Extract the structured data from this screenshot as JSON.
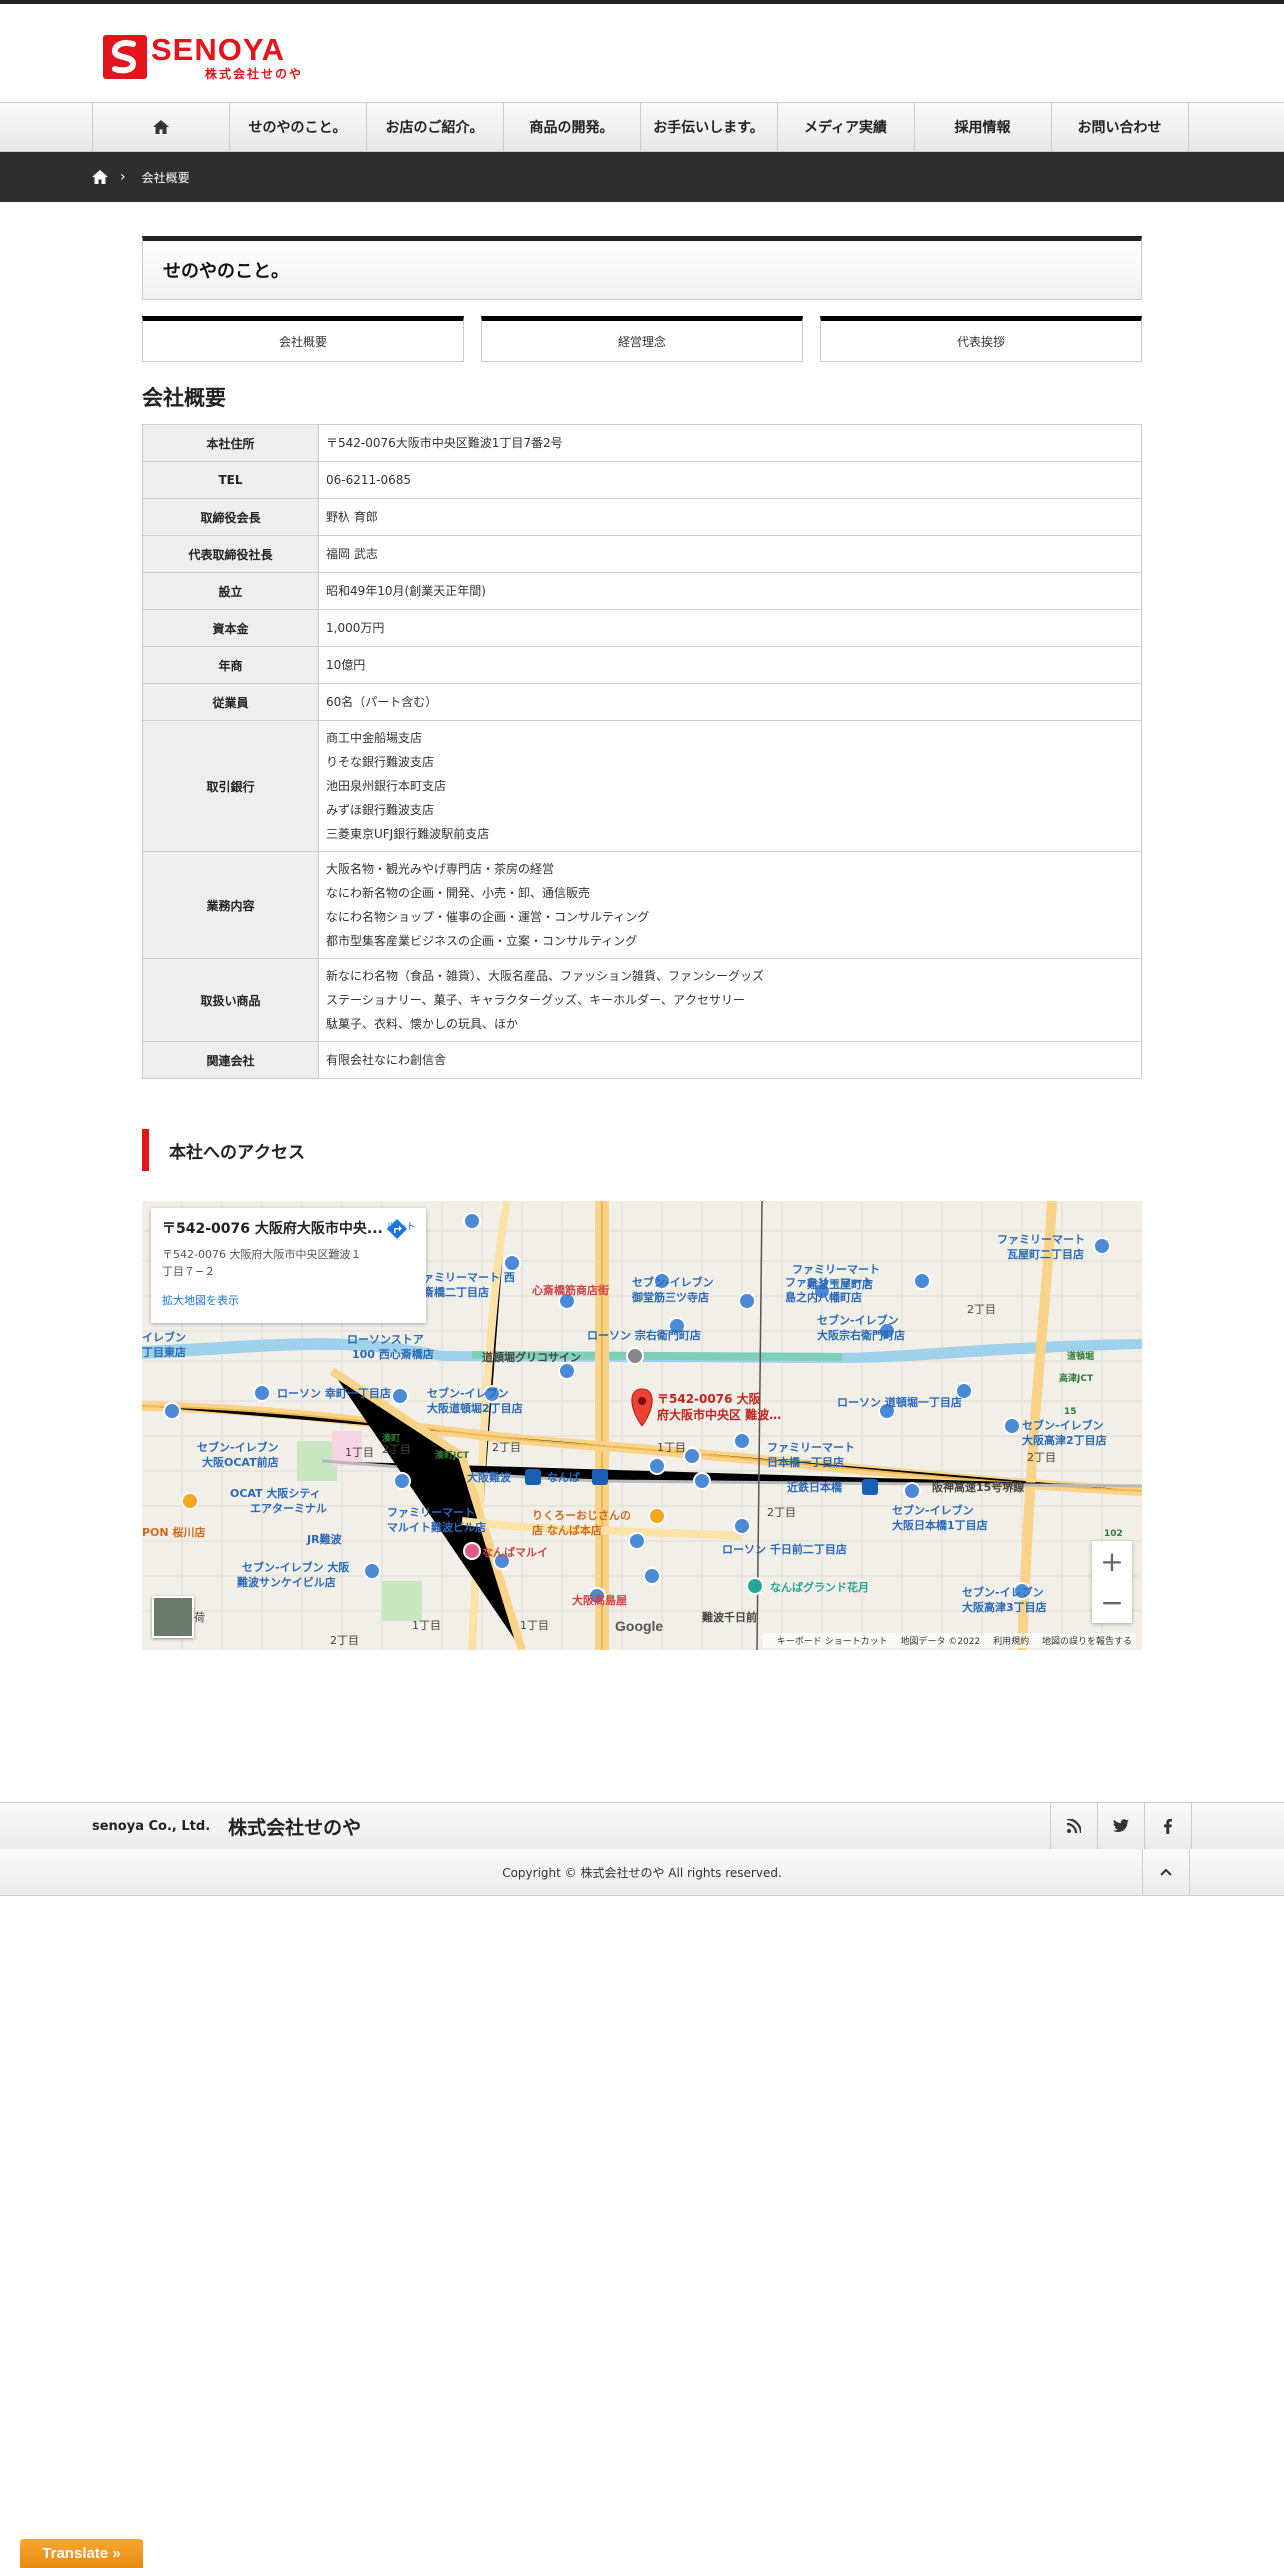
{
  "logo": {
    "name_en": "SENOYA",
    "name_jp": "株式会社せのや"
  },
  "nav": {
    "items": [
      "せのやのこと。",
      "お店のご紹介。",
      "商品の開発。",
      "お手伝いします。",
      "メディア実績",
      "採用情報",
      "お問い合わせ"
    ]
  },
  "breadcrumb": {
    "current": "会社概要"
  },
  "page": {
    "title": "せのやのこと。",
    "tabs": [
      "会社概要",
      "経営理念",
      "代表挨拶"
    ],
    "section_title": "会社概要"
  },
  "company_table": [
    {
      "label": "本社住所",
      "lines": [
        "〒542-0076大阪市中央区難波1丁目7番2号"
      ]
    },
    {
      "label": "TEL",
      "lines": [
        "06-6211-0685"
      ]
    },
    {
      "label": "取締役会長",
      "lines": [
        "野杁 育郎"
      ]
    },
    {
      "label": "代表取締役社長",
      "lines": [
        "福岡 武志"
      ]
    },
    {
      "label": "設立",
      "lines": [
        "昭和49年10月(創業天正年間)"
      ]
    },
    {
      "label": "資本金",
      "lines": [
        "1,000万円"
      ]
    },
    {
      "label": "年商",
      "lines": [
        "10億円"
      ]
    },
    {
      "label": "従業員",
      "lines": [
        "60名（パート含む）"
      ]
    },
    {
      "label": "取引銀行",
      "lines": [
        "商工中金船場支店",
        "りそな銀行難波支店",
        "池田泉州銀行本町支店",
        "みずほ銀行難波支店",
        "三菱東京UFJ銀行難波駅前支店"
      ]
    },
    {
      "label": "業務内容",
      "lines": [
        "大阪名物・観光みやげ専門店・茶房の経営",
        "なにわ新名物の企画・開発、小売・卸、通信販売",
        "なにわ名物ショップ・催事の企画・運営・コンサルティング",
        "都市型集客産業ビジネスの企画・立案・コンサルティング"
      ]
    },
    {
      "label": "取扱い商品",
      "lines": [
        "新なにわ名物（食品・雑貨）、大阪名産品、ファッション雑貨、ファンシーグッズ",
        "ステーショナリー、菓子、キャラクターグッズ、キーホルダー、アクセサリー",
        "駄菓子、衣料、懐かしの玩具、ほか"
      ]
    },
    {
      "label": "関連会社",
      "lines": [
        "有限会社なにわ創信舎"
      ]
    }
  ],
  "access": {
    "title": "本社へのアクセス"
  },
  "map": {
    "card_title": "〒542-0076 大阪府大阪市中央...",
    "card_address": "〒542-0076 大阪府大阪市中央区難波１丁目７−２",
    "card_link": "拡大地図を表示",
    "route_label": "ルート",
    "pin_label_1": "〒542-0076 大阪",
    "pin_label_2": "府大阪市中央区 難波…",
    "labels": {
      "l1": "心斎橋筋商店街",
      "l2": "ファミリーマート",
      "l3": "島之内八幡町店",
      "l4": "ファミリーマート 西",
      "l5": "心斎橋二丁目店",
      "l6": "セブン-イレブン",
      "l7": "御堂筋三ツ寺店",
      "l8": "ファミリーマート",
      "l9": "難波玉屋町店",
      "l10": "ローソンストア",
      "l11": "100 西心斎橋店",
      "l12": "ローソン 宗右衛門町店",
      "l13": "セブン-イレブン",
      "l14": "大阪宗右衛門町店",
      "l15": "道頓堀グリコサイン",
      "l16": "ローソン 幸町一丁目店",
      "l17": "セブン-イレブン",
      "l18": "大阪道頓堀2丁目店",
      "l19": "ローソン 道頓堀一丁目店",
      "l20": "ファミリーマート",
      "l21": "日本橋一丁目店",
      "l22": "セブン-イレブン",
      "l23": "大阪OCAT前店",
      "l24": "OCAT 大阪シティ",
      "l25": "エアターミナル",
      "l26": "大阪難波",
      "l27": "なんば",
      "l28": "近鉄日本橋",
      "l29": "阪神高速15号堺線",
      "l30": "ファミリーマート",
      "l31": "マルイト難波ビル店",
      "l32": "りくろーおじさんの",
      "l33": "店 なんば本店",
      "l34": "JR難波",
      "l35": "なんばマルイ",
      "l36": "ローソン 千日前二丁目店",
      "l37": "なんばグランド花月",
      "l38": "大阪高島屋",
      "l39": "難波千日前",
      "l40": "セブン-イレブン 大阪",
      "l41": "難波サンケイビル店",
      "l42": "2丁目",
      "l43": "1丁目",
      "l44": "ファミリーマート",
      "l45": "瓦屋町二丁目店",
      "l46": "セブン-イレブン",
      "l47": "大阪高津2丁目店",
      "l48": "セブン-イレブン",
      "l49": "大阪日本橋1丁目店",
      "l50": "セブン-イレブン",
      "l51": "大阪高津3丁目店",
      "l52": "PON 桜川店",
      "l53": "荷",
      "l54": "2丁目",
      "l55": "1丁目",
      "l56": "2丁目",
      "l57": "1丁目",
      "l58": "2丁目",
      "l59": "2丁目",
      "l60": "1丁目",
      "l61": "2丁目",
      "l62": "イレブン",
      "l63": "丁目東店",
      "l64": "道頓堀",
      "l65": "高津JCT",
      "l66": "湊町",
      "l67": "湊町JCT",
      "l68": "15",
      "l69": "102"
    },
    "footer_keyboard": "キーボード ショートカット",
    "footer_data": "地図データ ©2022",
    "footer_terms": "利用規約",
    "footer_report": "地図の誤りを報告する",
    "google": "Google"
  },
  "footer": {
    "company_en": "senoya Co., Ltd.",
    "company_jp": "株式会社せのや",
    "social": [
      "rss-icon",
      "twitter-icon",
      "facebook-icon"
    ],
    "copyright": "Copyright ©  株式会社せのや All rights reserved."
  },
  "translate": {
    "label": "Translate »"
  },
  "colors": {
    "brand_red": "#e3151b",
    "breadcrumb_bg": "#2e2e2e",
    "translate_orange": "#f29b1d"
  }
}
